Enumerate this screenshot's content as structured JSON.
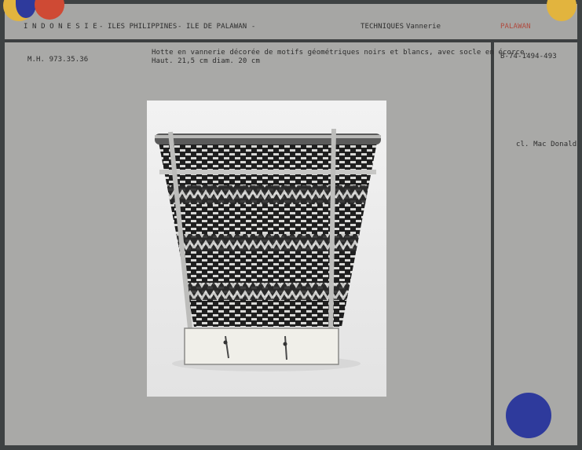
{
  "header": {
    "region": "I N D O N E S I E",
    "area": "- ILES PHILIPPINES",
    "island": "- ILE DE PALAWAN  -",
    "category_label": "TECHNIQUES",
    "category_value": "Vannerie",
    "place": "PALAWAN"
  },
  "record": {
    "inventory_number": "M.H. 973.35.36",
    "description_line1": "Hotte en vannerie décorée de motifs géométriques noirs et blancs, avec socle en écorce.",
    "description_line2": "Haut. 21,5 cm  diam. 20 cm",
    "negative_number": "B-74-1494-493",
    "photographer": "cl. Mac Donald"
  },
  "colors": {
    "dot_yellow": "#e2b43e",
    "dot_blue": "#2e3a9c",
    "dot_red": "#cf4a34",
    "place_text": "#b04a3e",
    "card": "#a9a9a7",
    "frame": "#3c3f40"
  },
  "image": {
    "subject": "woven basket photograph"
  }
}
